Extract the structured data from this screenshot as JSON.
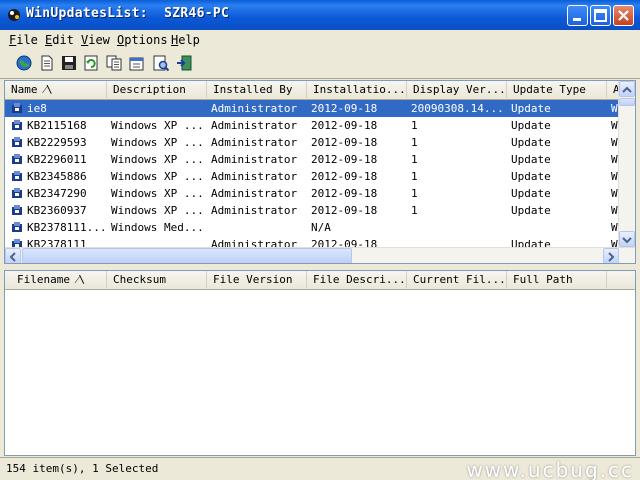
{
  "window": {
    "title": "WinUpdatesList:  SZR46-PC"
  },
  "menu": [
    {
      "label": "File",
      "ul": "F",
      "rest": "ile"
    },
    {
      "label": "Edit",
      "ul": "E",
      "rest": "dit"
    },
    {
      "label": "View",
      "ul": "V",
      "rest": "iew"
    },
    {
      "label": "Options",
      "ul": "O",
      "rest": "ptions"
    },
    {
      "label": "Help",
      "ul": "H",
      "rest": "elp"
    }
  ],
  "toolbar": [
    "globe-icon",
    "document-icon",
    "save-icon",
    "refresh-icon",
    "copy-icon",
    "properties-icon",
    "find-icon",
    "exit-icon"
  ],
  "top_list": {
    "columns": [
      "Name  ⁄\\",
      "Description",
      "Installed By",
      "Installatio...",
      "Display Ver...",
      "Update Type",
      "A"
    ],
    "rows": [
      [
        "ie8",
        "",
        "Administrator",
        "2012-09-18",
        "20090308.14...",
        "Update",
        "W"
      ],
      [
        "KB2115168",
        "Windows XP ...",
        "Administrator",
        "2012-09-18",
        "1",
        "Update",
        "W"
      ],
      [
        "KB2229593",
        "Windows XP ...",
        "Administrator",
        "2012-09-18",
        "1",
        "Update",
        "W"
      ],
      [
        "KB2296011",
        "Windows XP ...",
        "Administrator",
        "2012-09-18",
        "1",
        "Update",
        "W"
      ],
      [
        "KB2345886",
        "Windows XP ...",
        "Administrator",
        "2012-09-18",
        "1",
        "Update",
        "W"
      ],
      [
        "KB2347290",
        "Windows XP ...",
        "Administrator",
        "2012-09-18",
        "1",
        "Update",
        "W"
      ],
      [
        "KB2360937",
        "Windows XP ...",
        "Administrator",
        "2012-09-18",
        "1",
        "Update",
        "W"
      ],
      [
        "KB2378111...",
        "Windows Med...",
        "",
        "N/A",
        "",
        "",
        "W"
      ],
      [
        "KB2378111",
        "",
        "Administrator",
        "2012-09-18",
        "",
        "Update",
        "W"
      ]
    ],
    "selected_index": 0
  },
  "bottom_list": {
    "columns": [
      "Filename  ⁄\\",
      "Checksum",
      "File Version",
      "File Descri...",
      "Current Fil...",
      "Full Path"
    ]
  },
  "status": {
    "text": "154 item(s), 1 Selected",
    "watermark": "www.ucbug.cc"
  },
  "colors": {
    "selection": "#316ac5",
    "titlebar": "#0a5fd8"
  }
}
